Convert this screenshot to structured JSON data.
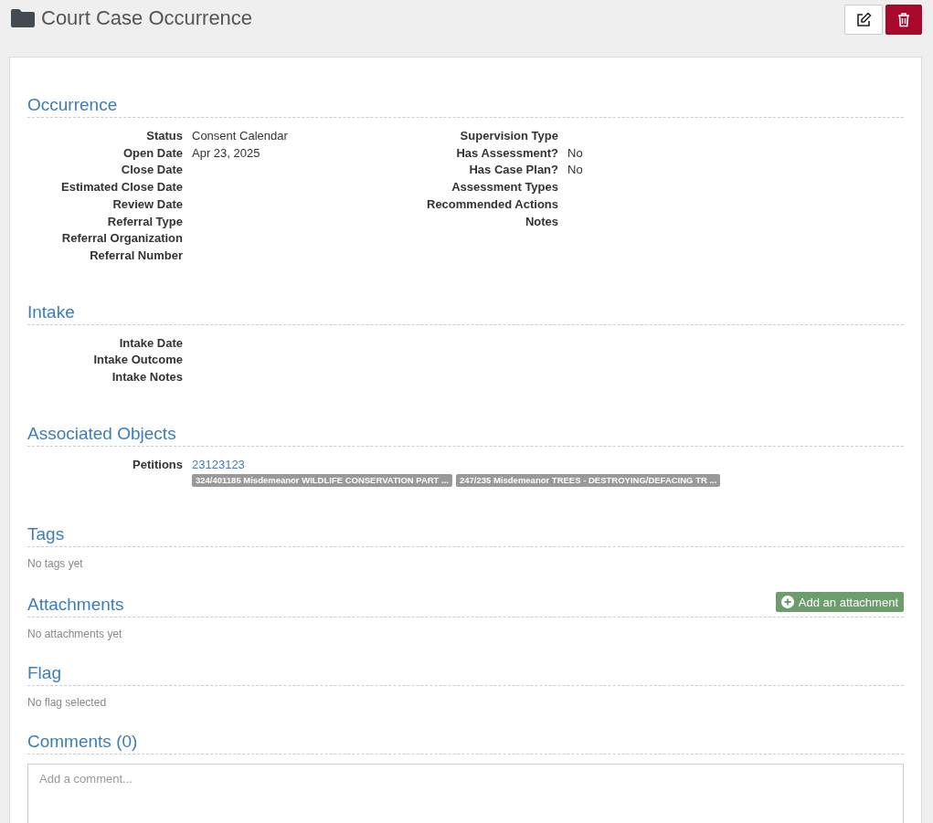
{
  "page": {
    "title": "Court Case Occurrence"
  },
  "sections": [
    {
      "kind": "fields",
      "title": "Occurrence",
      "left_fields": [
        {
          "label": "Status",
          "value": "Consent Calendar"
        },
        {
          "label": "Open Date",
          "value": "Apr 23, 2025"
        },
        {
          "label": "Close Date"
        },
        {
          "label": "Estimated Close Date"
        },
        {
          "label": "Review Date"
        },
        {
          "label": "Referral Type"
        },
        {
          "label": "Referral Organization"
        },
        {
          "label": "Referral Number"
        }
      ],
      "right_fields": [
        {
          "label": "Supervision Type"
        },
        {
          "label": "Has Assessment?",
          "value": "No"
        },
        {
          "label": "Has Case Plan?",
          "value": "No"
        },
        {
          "label": "Assessment Types"
        },
        {
          "label": "Recommended Actions"
        },
        {
          "label": "Notes"
        }
      ]
    },
    {
      "kind": "fields",
      "title": "Intake",
      "left_fields": [
        {
          "label": "Intake Date"
        },
        {
          "label": "Intake Outcome"
        },
        {
          "label": "Intake Notes"
        }
      ]
    },
    {
      "kind": "associated",
      "title": "Associated Objects",
      "rows": [
        {
          "label": "Petitions",
          "link": "23123123",
          "tags": [
            "324/401185 Misdemeanor WILDLIFE CONSERVATION PART ...",
            "247/235 Misdemeanor TREES - DESTROYING/DEFACING TR ..."
          ]
        }
      ]
    },
    {
      "kind": "empty",
      "title": "Tags",
      "empty_text": "No tags yet"
    },
    {
      "kind": "empty",
      "title": "Attachments",
      "action": "Add an attachment",
      "empty_text": "No attachments yet"
    },
    {
      "kind": "empty",
      "title": "Flag",
      "empty_text": "No flag selected"
    },
    {
      "kind": "comments",
      "title": "Comments (0)",
      "placeholder": "Add a comment..."
    }
  ]
}
